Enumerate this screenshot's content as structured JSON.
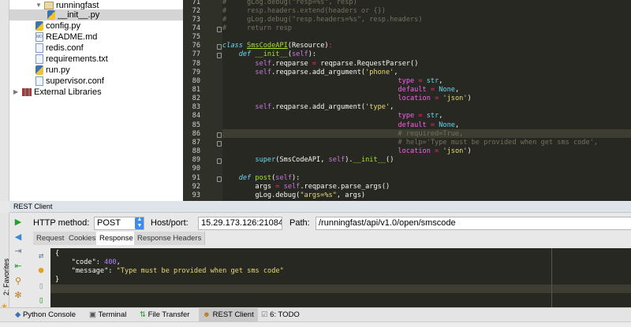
{
  "tree": {
    "items": [
      {
        "label": "runningfast",
        "icon": "folder-icon",
        "expanded": true
      },
      {
        "label": "__init__.py",
        "icon": "python-file-icon",
        "selected": true
      },
      {
        "label": "config.py",
        "icon": "python-file-icon"
      },
      {
        "label": "README.md",
        "icon": "markdown-file-icon"
      },
      {
        "label": "redis.conf",
        "icon": "text-file-icon"
      },
      {
        "label": "requirements.txt",
        "icon": "text-file-icon"
      },
      {
        "label": "run.py",
        "icon": "python-file-icon"
      },
      {
        "label": "supervisor.conf",
        "icon": "text-file-icon"
      },
      {
        "label": "External Libraries",
        "icon": "library-icon",
        "expanded": false
      }
    ]
  },
  "editor": {
    "lines": [
      {
        "n": "71",
        "t": [
          [
            "cm",
            "#     gLog.debug(\"resp=%s\", resp)"
          ]
        ]
      },
      {
        "n": "72",
        "t": [
          [
            "cm",
            "#     resp.headers.extend(headers or {})"
          ]
        ]
      },
      {
        "n": "73",
        "t": [
          [
            "cm",
            "#     gLog.debug(\"resp.headers=%s\", resp.headers)"
          ]
        ]
      },
      {
        "n": "74",
        "t": [
          [
            "cm",
            "#     return resp"
          ]
        ]
      },
      {
        "n": "75",
        "t": []
      },
      {
        "n": "76",
        "t": [
          [
            "kw",
            "class "
          ],
          [
            "cn",
            "SmsCodeAPI"
          ],
          [
            "",
            "(Resource)"
          ],
          [
            "op",
            ":"
          ]
        ]
      },
      {
        "n": "77",
        "t": [
          [
            "",
            "    "
          ],
          [
            "kw",
            "def "
          ],
          [
            "fn",
            "__init__"
          ],
          [
            "",
            "("
          ],
          [
            "self",
            "self"
          ],
          [
            "",
            "):"
          ]
        ]
      },
      {
        "n": "78",
        "t": [
          [
            "",
            "        "
          ],
          [
            "self",
            "self"
          ],
          [
            "",
            ".reqparse "
          ],
          [
            "op",
            "="
          ],
          [
            "",
            " reqparse.RequestParser()"
          ]
        ]
      },
      {
        "n": "79",
        "t": [
          [
            "",
            "        "
          ],
          [
            "self",
            "self"
          ],
          [
            "",
            ".reqparse.add_argument("
          ],
          [
            "st",
            "'phone'"
          ],
          [
            "",
            ","
          ]
        ]
      },
      {
        "n": "80",
        "t": [
          [
            "",
            "                                           "
          ],
          [
            "pr",
            "type"
          ],
          [
            "op",
            " = "
          ],
          [
            "bi",
            "str"
          ],
          [
            "",
            ","
          ]
        ]
      },
      {
        "n": "81",
        "t": [
          [
            "",
            "                                           "
          ],
          [
            "pr",
            "default"
          ],
          [
            "op",
            " = "
          ],
          [
            "bi",
            "None"
          ],
          [
            "",
            ","
          ]
        ]
      },
      {
        "n": "82",
        "t": [
          [
            "",
            "                                           "
          ],
          [
            "pr",
            "location"
          ],
          [
            "op",
            " = "
          ],
          [
            "st",
            "'json'"
          ],
          [
            "",
            ")"
          ]
        ]
      },
      {
        "n": "83",
        "t": [
          [
            "",
            "        "
          ],
          [
            "self",
            "self"
          ],
          [
            "",
            ".reqparse.add_argument("
          ],
          [
            "st",
            "'type'"
          ],
          [
            "",
            ","
          ]
        ]
      },
      {
        "n": "84",
        "t": [
          [
            "",
            "                                           "
          ],
          [
            "pr",
            "type"
          ],
          [
            "op",
            " = "
          ],
          [
            "bi",
            "str"
          ],
          [
            "",
            ","
          ]
        ]
      },
      {
        "n": "85",
        "t": [
          [
            "",
            "                                           "
          ],
          [
            "pr",
            "default"
          ],
          [
            "op",
            " = "
          ],
          [
            "bi",
            "None"
          ],
          [
            "",
            ","
          ]
        ]
      },
      {
        "n": "86",
        "t": [
          [
            "",
            "                                           "
          ],
          [
            "cm",
            "# required=True,"
          ]
        ]
      },
      {
        "n": "87",
        "t": [
          [
            "",
            "                                           "
          ],
          [
            "cm",
            "# help='Type must be provided when get sms code',"
          ]
        ]
      },
      {
        "n": "88",
        "t": [
          [
            "",
            "                                           "
          ],
          [
            "pr",
            "location"
          ],
          [
            "op",
            " = "
          ],
          [
            "st",
            "'json'"
          ],
          [
            "",
            ")"
          ]
        ]
      },
      {
        "n": "89",
        "t": [
          [
            "",
            "        "
          ],
          [
            "bi",
            "super"
          ],
          [
            "",
            "(SmsCodeAPI, "
          ],
          [
            "self",
            "self"
          ],
          [
            "",
            ")."
          ],
          [
            "fn",
            "__init__"
          ],
          [
            "",
            "()"
          ]
        ]
      },
      {
        "n": "90",
        "t": []
      },
      {
        "n": "91",
        "t": [
          [
            "",
            "    "
          ],
          [
            "kw",
            "def "
          ],
          [
            "fn",
            "post"
          ],
          [
            "",
            "("
          ],
          [
            "self",
            "self"
          ],
          [
            "",
            "):"
          ]
        ]
      },
      {
        "n": "92",
        "t": [
          [
            "",
            "        args "
          ],
          [
            "op",
            "="
          ],
          [
            " ",
            " "
          ],
          [
            "self",
            "self"
          ],
          [
            "",
            ".reqparse.parse_args()"
          ]
        ]
      },
      {
        "n": "93",
        "t": [
          [
            "",
            "        gLog.debug("
          ],
          [
            "st",
            "\"args=%s\""
          ],
          [
            "",
            ", args)"
          ]
        ]
      }
    ]
  },
  "rest": {
    "title": "REST Client",
    "method_label": "HTTP method:",
    "method": "POST",
    "host_label": "Host/port:",
    "host": "15.29.173.126:21084",
    "path_label": "Path:",
    "path": "/runningfast/api/v1.0/open/smscode",
    "tabs": [
      "Request",
      "Cookies",
      "Response",
      "Response Headers"
    ],
    "active_tab": "Response",
    "response": [
      "{",
      "    \"code\": 400,",
      "    \"message\": \"Type must be provided when get sms code\"",
      "}"
    ],
    "response_code": "400",
    "response_message": "\"Type must be provided when get sms code\""
  },
  "favorites_label": "2: Favorites",
  "bottom_tools": [
    "Python Console",
    "Terminal",
    "File Transfer",
    "REST Client",
    "6: TODO"
  ],
  "active_tool": "REST Client"
}
